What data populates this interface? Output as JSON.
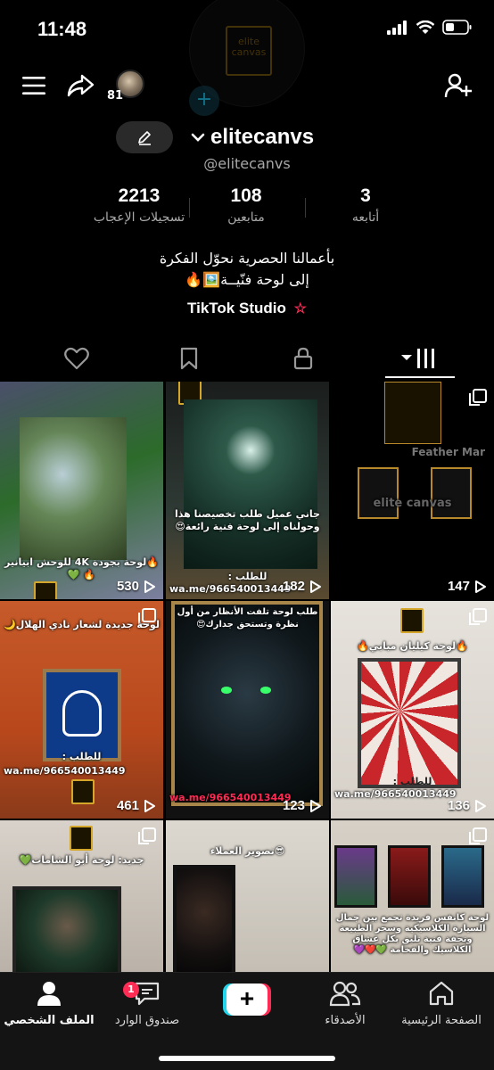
{
  "status_bar": {
    "time": "11:48"
  },
  "topbar": {
    "avatar_count": "81"
  },
  "profile": {
    "username": "elitecanvs",
    "handle": "@elitecanvs",
    "ghost_logo_text": "elite canvas"
  },
  "stats": [
    {
      "value": "2213",
      "label": "تسجيلات الإعجاب"
    },
    {
      "value": "108",
      "label": "متابعين"
    },
    {
      "value": "3",
      "label": "أتابعه"
    }
  ],
  "bio": {
    "line1": "بأعمالنا الحصرية نحوّل الفكرة",
    "line2": "إلى لوحة فنّيــة🖼️🔥"
  },
  "studio": {
    "label": "TikTok Studio"
  },
  "grid": [
    {
      "views": "530",
      "caption": "🔥لوحة بجودة 4K للوحش ابيانير 🔥 💚"
    },
    {
      "views": "182",
      "caption": "جاني عميل طلب تخصيصنا هذا وحولناه إلى لوحة فنية رائعة😍",
      "caption2": "للطلب :",
      "caption3": "wa.me/966540013449"
    },
    {
      "views": "147",
      "caption": "elite canvas",
      "caption2": "Feather Mar"
    },
    {
      "views": "461",
      "caption": "لوحة جديدة لشعار نادي الهلال🌙",
      "caption2": "للطلب :",
      "caption3": "wa.me/966540013449"
    },
    {
      "views": "123",
      "caption": "طلب لوحة تلفت الأنظار من أول نظرة وتستحق جدارك😍",
      "caption3": "wa.me/966540013449"
    },
    {
      "views": "136",
      "caption": "🔥لوحة كيليان مبابي🔥",
      "caption2": "للطلب :",
      "caption3": "wa.me/966540013449"
    },
    {
      "views": "",
      "caption": "جديد: لوحة أبو الشامات💚"
    },
    {
      "views": "",
      "caption": "😎تصوير العملاء"
    },
    {
      "views": "",
      "caption": "لوحة كانفس فريدة تجمع بين جمال السيارة الكلاسيكية وسحر الطبيعة وتحفة فنية تليق بكل عشاق الكلاسيك والفخامة 💚❤️💜"
    }
  ],
  "bottom_nav": {
    "profile": "الملف الشخصي",
    "inbox": "صندوق الوارد",
    "inbox_badge": "1",
    "friends": "الأصدقاء",
    "home": "الصفحة الرئيسية"
  },
  "colors": {
    "accent_red": "#fe2c55",
    "accent_cyan": "#20d5ec",
    "gold": "#d4a62a"
  }
}
